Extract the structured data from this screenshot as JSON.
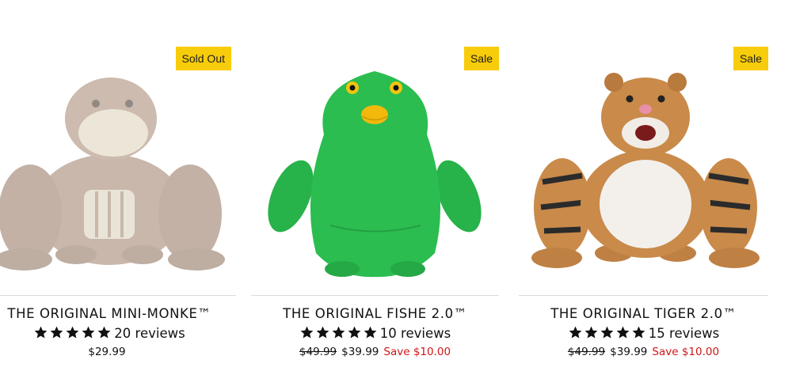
{
  "products": [
    {
      "title": "THE ORIGINAL MINI-MONKE™",
      "badge": "Sold Out",
      "rating": 5,
      "reviews_label": "20 reviews",
      "price": "$29.99",
      "image_icon": "monkey-toy-image"
    },
    {
      "title": "THE ORIGINAL FISHE 2.0™",
      "badge": "Sale",
      "rating": 5,
      "reviews_label": "10 reviews",
      "compare_price": "$49.99",
      "price": "$39.99",
      "save_label": "Save $10.00",
      "image_icon": "fish-toy-image"
    },
    {
      "title": "THE ORIGINAL TIGER 2.0™",
      "badge": "Sale",
      "rating": 5,
      "reviews_label": "15 reviews",
      "compare_price": "$49.99",
      "price": "$39.99",
      "save_label": "Save $10.00",
      "image_icon": "tiger-toy-image"
    }
  ],
  "colors": {
    "badge": "#f7cc0a",
    "save": "#d01616",
    "star": "#111111"
  }
}
